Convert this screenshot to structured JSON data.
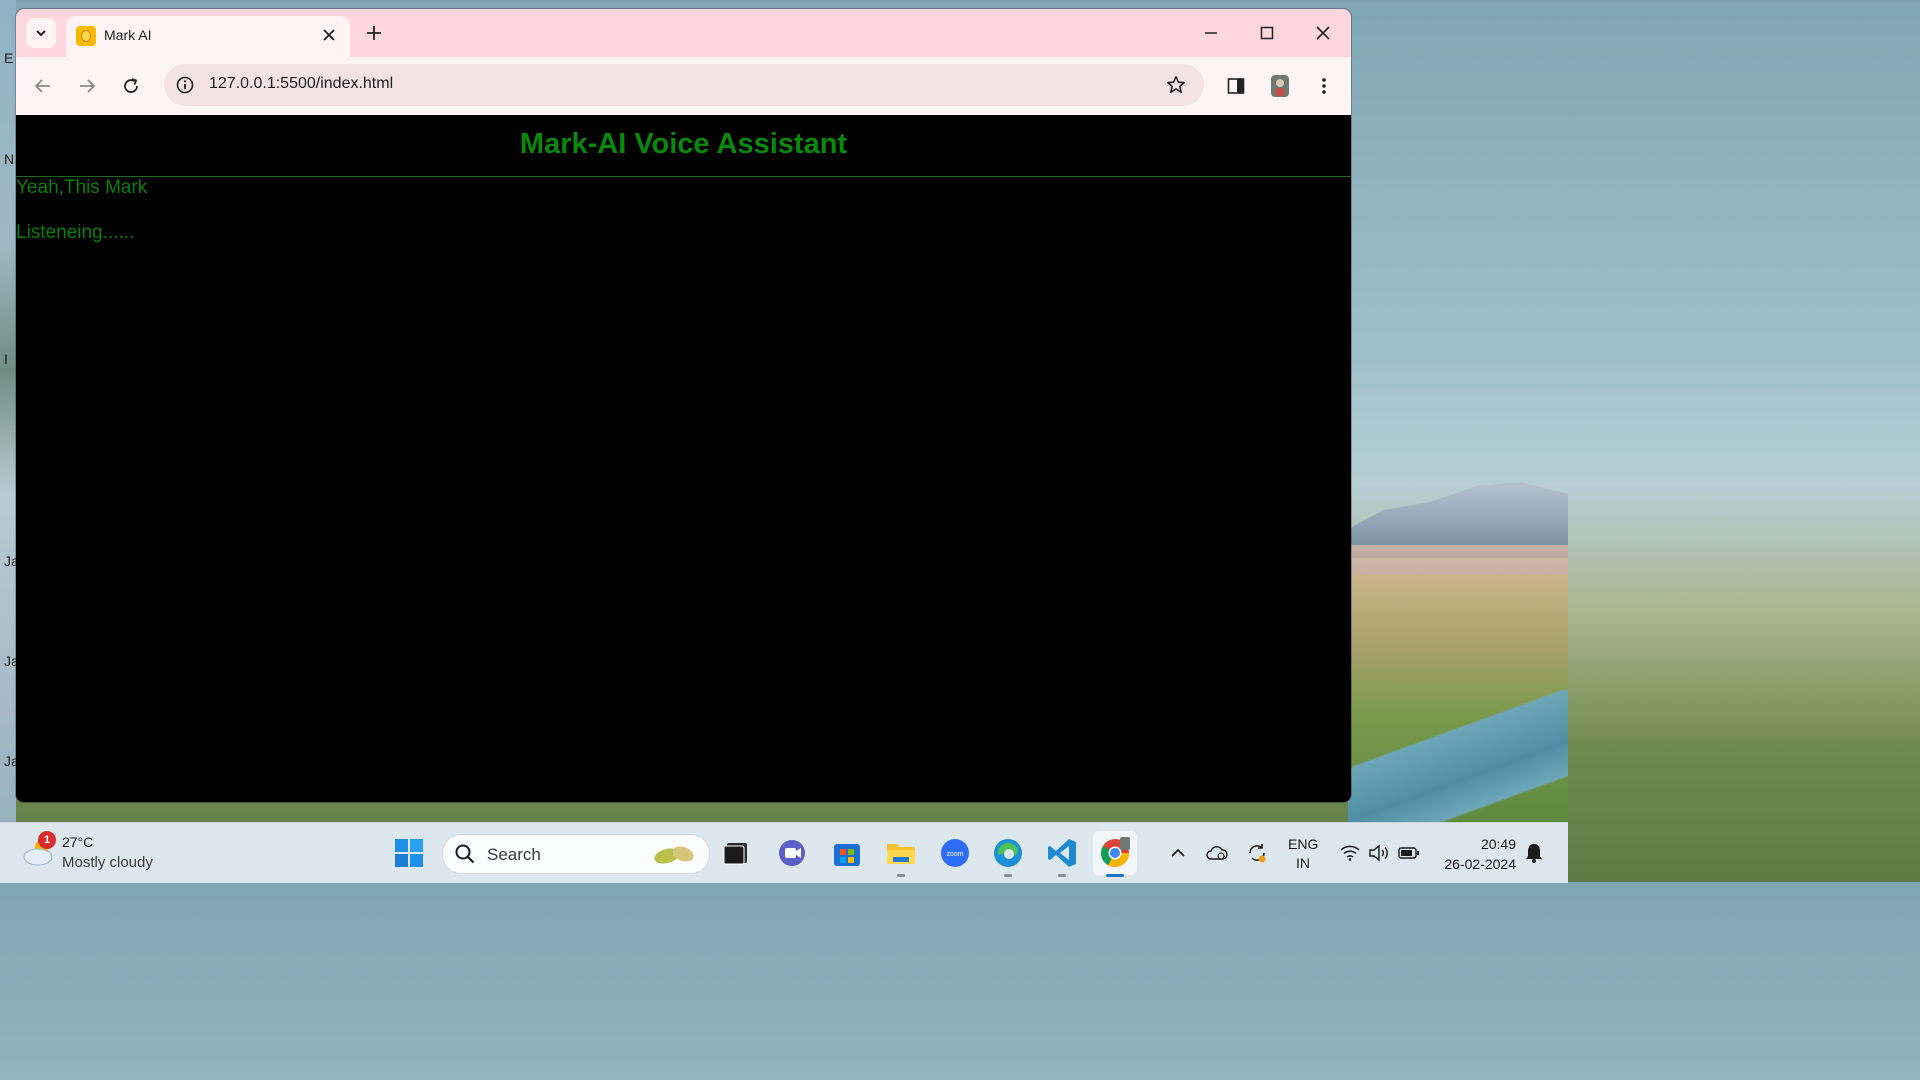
{
  "browser": {
    "tab_title": "Mark AI",
    "url": "127.0.0.1:5500/index.html"
  },
  "page": {
    "title": "Mark-AI Voice Assistant",
    "messages": [
      "Yeah,This Mark",
      "Listeneing......"
    ],
    "text_color": "#0a8a0a",
    "background_color": "#000000"
  },
  "taskbar": {
    "weather_alert_count": "1",
    "temperature": "27°C",
    "weather_desc": "Mostly cloudy",
    "search_label": "Search",
    "language_line1": "ENG",
    "language_line2": "IN",
    "time": "20:49",
    "date": "26-02-2024",
    "apps": [
      "windows-start-icon",
      "file-manager-icon",
      "teams-icon",
      "microsoft-store-icon",
      "file-explorer-icon",
      "zoom-icon",
      "edge-icon",
      "vscode-icon",
      "chrome-icon"
    ]
  },
  "desktop": {
    "edge_letters": [
      "E",
      "N",
      "I",
      "Ja",
      "Ja",
      "Ja"
    ]
  }
}
